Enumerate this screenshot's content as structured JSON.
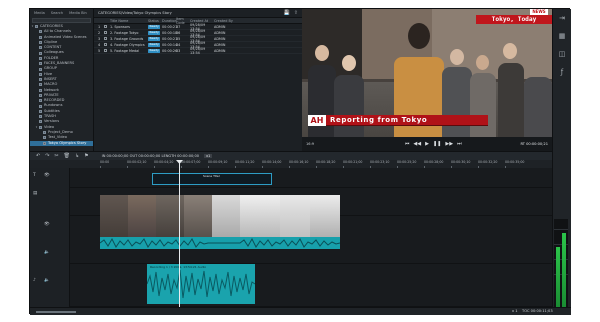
{
  "browser": {
    "tabs": [
      "Media",
      "Search",
      "Media Bin"
    ],
    "tree": [
      "CATEGORIES",
      "All to Channels",
      "Animated Video Scenes",
      "Clipline",
      "CONTENT",
      "Colleagues",
      "FOLDER",
      "FACES_BANNERS",
      "GROUP",
      "Hive",
      "INSERT",
      "MACRO",
      "Network",
      "PRIVATE",
      "RECORDED",
      "Rundowns",
      "Subtitles",
      "TRASH",
      "Versions",
      "Video",
      "Project_Demo",
      "Test_Video",
      "Tokyo Olympics Story"
    ],
    "selected_tree_index": 22
  },
  "list": {
    "path": "CATEGORIES/Video/Tokyo Olympics Story",
    "columns": [
      "",
      "",
      "Title Name",
      "Status",
      "Duration",
      "Item Code",
      "Created At",
      "Created By"
    ],
    "rows": [
      {
        "n": "1",
        "title": "1. Sponsors",
        "status": "Ready",
        "duration": "00:00:21",
        "code": "37",
        "created": "09/28/09 13:54",
        "by": "ADMIN"
      },
      {
        "n": "2",
        "title": "2. Footage Tokyo",
        "status": "Ready",
        "duration": "00:00:18",
        "code": "36",
        "created": "09/28/09 13:54",
        "by": "ADMIN"
      },
      {
        "n": "3",
        "title": "3. Footage Grounds",
        "status": "Ready",
        "duration": "00:00:21",
        "code": "35",
        "created": "09/28/09 13:54",
        "by": "ADMIN"
      },
      {
        "n": "4",
        "title": "4. Footage Olympics",
        "status": "Ready",
        "duration": "00:00:14",
        "code": "34",
        "created": "09/28/09 13:54",
        "by": "ADMIN"
      },
      {
        "n": "5",
        "title": "5. Footage Medal",
        "status": "Ready",
        "duration": "00:00:26",
        "code": "33",
        "created": "09/28/09 13:54",
        "by": "ADMIN"
      }
    ]
  },
  "preview": {
    "title_overlay": "Tokyo, Today",
    "news_tag": "NEWS",
    "lower_third_logo": "AH",
    "lower_third_text": "Reporting from Tokyo",
    "aspect": "16:9",
    "timecode": "RT 00:00:00;21"
  },
  "timeline": {
    "toolbar_info": "IN 00:00:00;00   OUT 00:00:00;00   LENGTH 00:00:00;00",
    "zoom": "x1",
    "ruler_labels": [
      "00:00",
      "00:00:02;10",
      "00:00:04;20",
      "00:00:07;00",
      "00:00:09;10",
      "00:00:11;20",
      "00:00:14;00",
      "00:00:16;10",
      "00:00:18;20",
      "00:00:21;00",
      "00:00:23;10",
      "00:00:25;20",
      "00:00:28;00",
      "00:00:30;10",
      "00:00:32;20",
      "00:00:35;00"
    ],
    "title_clip": "Scene Titel",
    "audio_clip_label": "Recording 1 / 3 2009, 13:54:21 Audio",
    "status_right": "TOC 00:00:11;03",
    "status_zoom": "x 1"
  }
}
